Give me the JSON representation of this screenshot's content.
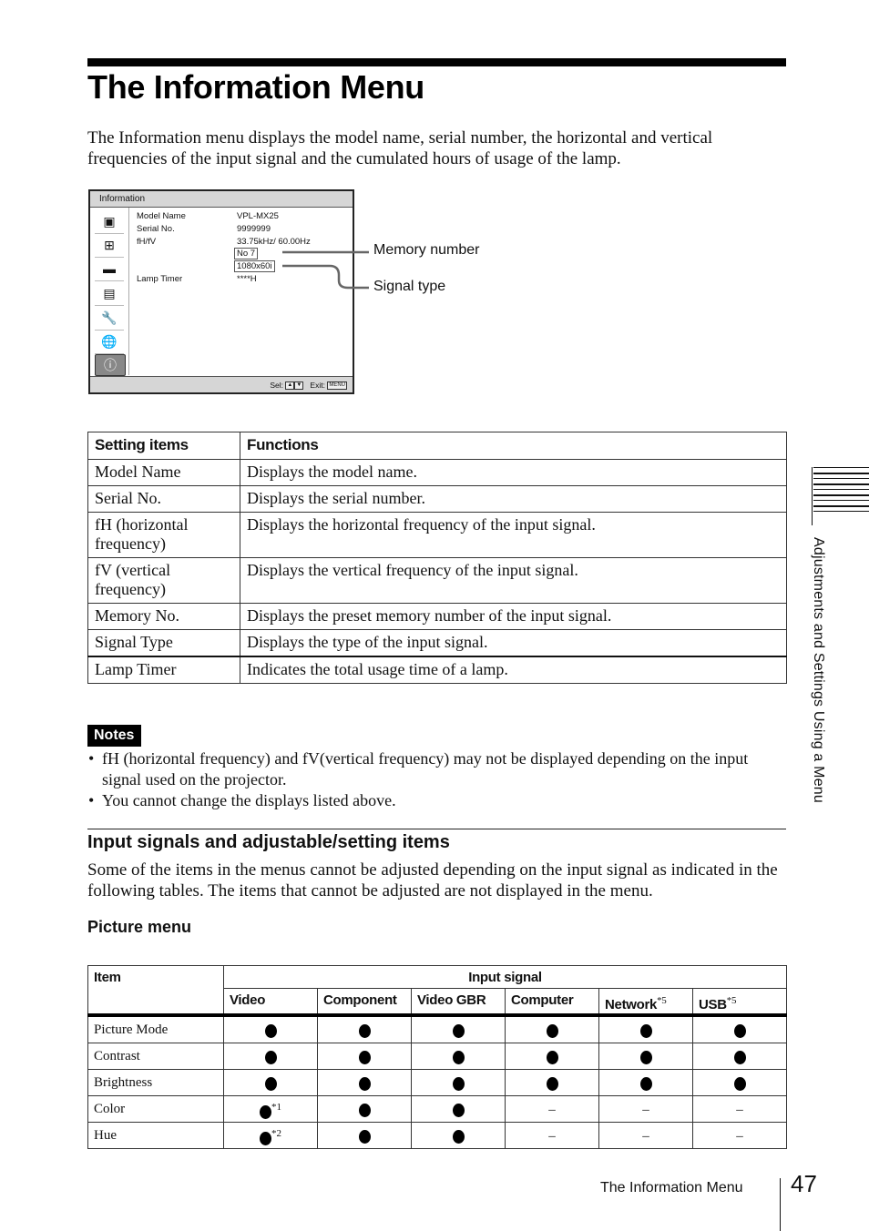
{
  "page": {
    "title": "The Information Menu",
    "intro": "The Information menu displays the model name, serial number, the horizontal and vertical frequencies of the input signal and the cumulated hours of usage of the lamp.",
    "side_tab": "Adjustments and Settings Using a Menu",
    "footer_label": "The Information Menu",
    "page_number": "47"
  },
  "osd": {
    "title": "Information",
    "icons": [
      "picture-icon",
      "screen-icon",
      "setup-icon",
      "menu-list-icon",
      "wrench-icon",
      "globe-icon",
      "info-icon"
    ],
    "rows": [
      {
        "label": "Model Name",
        "value": "VPL-MX25"
      },
      {
        "label": "Serial No.",
        "value": "9999999"
      },
      {
        "label": "fH/fV",
        "value": "33.75kHz/ 60.00Hz"
      },
      {
        "label": "Lamp Timer",
        "value": "****H"
      }
    ],
    "memory_box": "No 7",
    "signal_box": "1080x60i",
    "footer_sel": "Sel:",
    "footer_exit": "Exit:",
    "menu_key": "MENU",
    "up_key": "▲",
    "down_key": "▼"
  },
  "callouts": {
    "memory": "Memory number",
    "signal": "Signal type"
  },
  "info_table": {
    "headers": [
      "Setting items",
      "Functions"
    ],
    "rows": [
      [
        "Model Name",
        "Displays the model name."
      ],
      [
        "Serial No.",
        "Displays the serial number."
      ],
      [
        "fH (horizontal frequency)",
        "Displays the horizontal frequency of the input signal."
      ],
      [
        "fV (vertical frequency)",
        "Displays the vertical frequency of the input signal."
      ],
      [
        "Memory No.",
        "Displays the preset memory number of the input signal."
      ],
      [
        "Signal Type",
        "Displays the type of the input signal."
      ],
      [
        "Lamp Timer",
        "Indicates the total usage time of a lamp."
      ]
    ]
  },
  "notes": {
    "label": "Notes",
    "items": [
      "fH (horizontal frequency) and fV(vertical frequency) may not be displayed depending on the input signal used on the projector.",
      "You cannot change the displays listed above."
    ]
  },
  "section": {
    "title": "Input signals and adjustable/setting items",
    "body": "Some of the items in the menus cannot be adjusted depending on the input signal as indicated in the following tables. The items that cannot be adjusted are not displayed in the menu.",
    "subtitle": "Picture menu"
  },
  "picture_table": {
    "item_header": "Item",
    "group_header": "Input signal",
    "columns": [
      {
        "label": "Video",
        "sup": ""
      },
      {
        "label": "Component",
        "sup": ""
      },
      {
        "label": "Video GBR",
        "sup": ""
      },
      {
        "label": "Computer",
        "sup": ""
      },
      {
        "label": "Network",
        "sup": "*5"
      },
      {
        "label": "USB",
        "sup": "*5"
      }
    ],
    "rows": [
      {
        "item": "Picture Mode",
        "cells": [
          {
            "v": "dot",
            "sup": ""
          },
          {
            "v": "dot",
            "sup": ""
          },
          {
            "v": "dot",
            "sup": ""
          },
          {
            "v": "dot",
            "sup": ""
          },
          {
            "v": "dot",
            "sup": ""
          },
          {
            "v": "dot",
            "sup": ""
          }
        ]
      },
      {
        "item": "Contrast",
        "cells": [
          {
            "v": "dot",
            "sup": ""
          },
          {
            "v": "dot",
            "sup": ""
          },
          {
            "v": "dot",
            "sup": ""
          },
          {
            "v": "dot",
            "sup": ""
          },
          {
            "v": "dot",
            "sup": ""
          },
          {
            "v": "dot",
            "sup": ""
          }
        ]
      },
      {
        "item": "Brightness",
        "cells": [
          {
            "v": "dot",
            "sup": ""
          },
          {
            "v": "dot",
            "sup": ""
          },
          {
            "v": "dot",
            "sup": ""
          },
          {
            "v": "dot",
            "sup": ""
          },
          {
            "v": "dot",
            "sup": ""
          },
          {
            "v": "dot",
            "sup": ""
          }
        ]
      },
      {
        "item": "Color",
        "cells": [
          {
            "v": "dot",
            "sup": "*1"
          },
          {
            "v": "dot",
            "sup": ""
          },
          {
            "v": "dot",
            "sup": ""
          },
          {
            "v": "–",
            "sup": ""
          },
          {
            "v": "–",
            "sup": ""
          },
          {
            "v": "–",
            "sup": ""
          }
        ]
      },
      {
        "item": "Hue",
        "cells": [
          {
            "v": "dot",
            "sup": "*2"
          },
          {
            "v": "dot",
            "sup": ""
          },
          {
            "v": "dot",
            "sup": ""
          },
          {
            "v": "–",
            "sup": ""
          },
          {
            "v": "–",
            "sup": ""
          },
          {
            "v": "–",
            "sup": ""
          }
        ]
      }
    ]
  }
}
